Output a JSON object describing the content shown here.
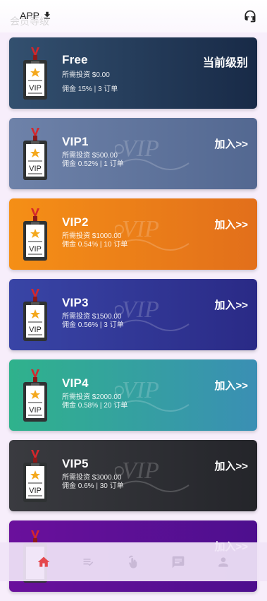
{
  "header": {
    "app_label": "APP",
    "page_title": "会员等级"
  },
  "levels": [
    {
      "name": "Free",
      "invest": "所需投资 $0.00",
      "commission": "佣金 15% | 3 订单",
      "action": "当前级别",
      "bg": "linear-gradient(90deg,#33506f,#182a47)"
    },
    {
      "name": "VIP1",
      "invest": "所需投资 $500.00",
      "commission": "佣金 0.52% | 1 订单",
      "action": "加入>>",
      "bg": "linear-gradient(90deg,#6e82a9,#536891)"
    },
    {
      "name": "VIP2",
      "invest": "所需投资 $1000.00",
      "commission": "佣金 0.54% | 10 订单",
      "action": "加入>>",
      "bg": "linear-gradient(90deg,#f58f16,#e26f1b)"
    },
    {
      "name": "VIP3",
      "invest": "所需投资 $1500.00",
      "commission": "佣金 0.56% | 3 订单",
      "action": "加入>>",
      "bg": "linear-gradient(90deg,#3945a6,#2a2a86)"
    },
    {
      "name": "VIP4",
      "invest": "所需投资 $2000.00",
      "commission": "佣金 0.58% | 20 订单",
      "action": "加入>>",
      "bg": "linear-gradient(90deg,#2fb28c,#3a8fb4)"
    },
    {
      "name": "VIP5",
      "invest": "所需投资 $3000.00",
      "commission": "佣金 0.6% | 30 订单",
      "action": "加入>>",
      "bg": "linear-gradient(90deg,#3a3b40,#24252a)"
    },
    {
      "name": "VIP6",
      "invest": "",
      "commission": "",
      "action": "加入>>",
      "bg": "linear-gradient(90deg,#6a109c,#4d0f8e)"
    }
  ],
  "nav": {
    "active_color": "#e5484d",
    "inactive_color": "#c9b9d6",
    "items": [
      "home-icon",
      "task-list-icon",
      "tap-icon",
      "message-icon",
      "profile-icon"
    ]
  }
}
